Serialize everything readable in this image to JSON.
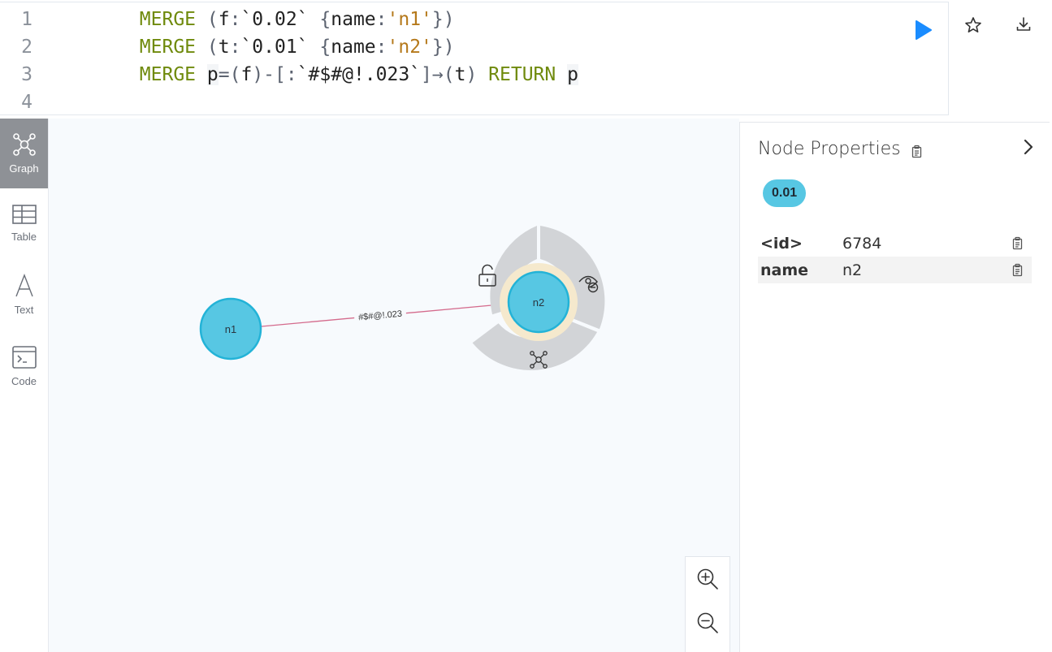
{
  "editor": {
    "lines": [
      {
        "num": "1",
        "kw": "MERGE",
        "p1": " (",
        "var": "f",
        "p2": ":",
        "lab": "`0.02`",
        "p3": " {",
        "key": "name",
        "p4": ":",
        "str": "'n1'",
        "p5": "})"
      },
      {
        "num": "2",
        "kw": "MERGE",
        "p1": " (",
        "var": "t",
        "p2": ":",
        "lab": "`0.01`",
        "p3": " {",
        "key": "name",
        "p4": ":",
        "str": "'n2'",
        "p5": "})"
      },
      {
        "num": "3",
        "kw": "MERGE",
        "p": "p",
        "eq": "=(",
        "f": "f",
        "mid": ")-[:",
        "rel": "`#$#@!.023`",
        "arrow": "]→(",
        "t": "t",
        "close": ")",
        "ret": "RETURN",
        "rp": "p"
      },
      {
        "num": "4"
      }
    ]
  },
  "sidebar": {
    "items": [
      {
        "label": "Graph",
        "icon": "graph-icon",
        "active": true
      },
      {
        "label": "Table",
        "icon": "table-icon"
      },
      {
        "label": "Text",
        "icon": "text-icon"
      },
      {
        "label": "Code",
        "icon": "code-icon"
      }
    ]
  },
  "graph": {
    "nodes": [
      {
        "id": "n1",
        "label": "n1"
      },
      {
        "id": "n2",
        "label": "n2",
        "selected": true
      }
    ],
    "relationship": {
      "label": "#$#@!.023"
    },
    "colors": {
      "node": "#57c7e3",
      "node_border": "#23b3d7",
      "edge": "#d46a8c",
      "ring": "#f5e9cd",
      "menu": "#d2d4d7"
    }
  },
  "panel": {
    "title": "Node Properties",
    "badge": "0.01",
    "properties": [
      {
        "key": "<id>",
        "value": "6784"
      },
      {
        "key": "name",
        "value": "n2"
      }
    ]
  }
}
